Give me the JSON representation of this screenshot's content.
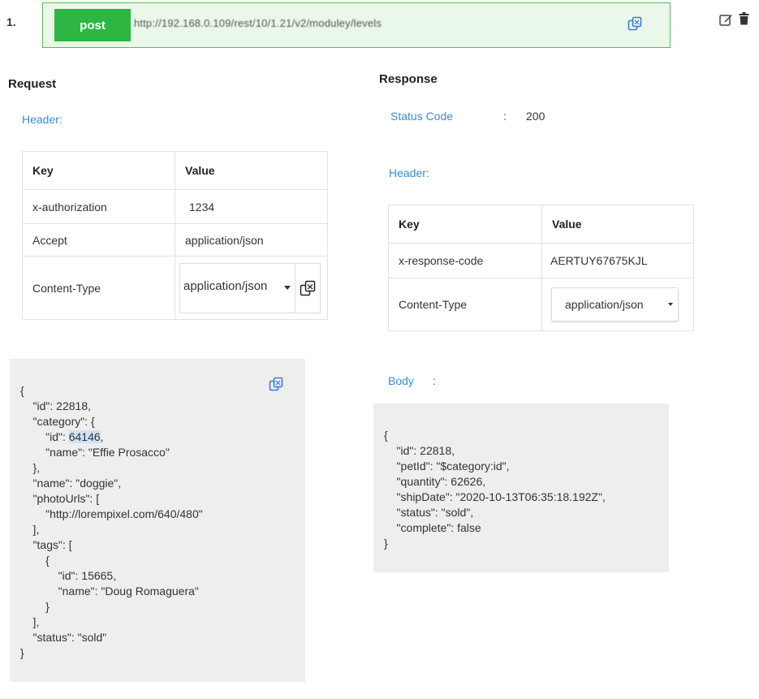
{
  "step": {
    "number": "1."
  },
  "endpoint": {
    "method": "post",
    "url": "http://192.168.0.109/rest/10/1.21/v2/moduley/levels"
  },
  "request": {
    "title": "Request",
    "header_label": "Header:",
    "table": {
      "key_header": "Key",
      "value_header": "Value",
      "rows": [
        {
          "key": "x-authorization",
          "value": "1234"
        },
        {
          "key": "Accept",
          "value": "application/json"
        },
        {
          "key": "Content-Type",
          "value": "application/json"
        }
      ]
    },
    "body": {
      "before_highlight": "{\n    \"id\": 22818,\n    \"category\": {\n        \"id\": ",
      "highlight": "64146",
      "after_highlight": ",\n        \"name\": \"Effie Prosacco\"\n    },\n    \"name\": \"doggie\",\n    \"photoUrls\": [\n        \"http://lorempixel.com/640/480\"\n    ],\n    \"tags\": [\n        {\n            \"id\": 15665,\n            \"name\": \"Doug Romaguera\"\n        }\n    ],\n    \"status\": \"sold\"\n}"
    }
  },
  "response": {
    "title": "Response",
    "status_label": "Status Code",
    "status_sep": ":",
    "status_value": "200",
    "header_label": "Header:",
    "table": {
      "key_header": "Key",
      "value_header": "Value",
      "rows": [
        {
          "key": "x-response-code",
          "value": "AERTUY67675KJL"
        },
        {
          "key": "Content-Type",
          "value": "application/json"
        }
      ]
    },
    "body_label": "Body",
    "body_sep": ":",
    "body": "{\n    \"id\": 22818,\n    \"petId\": \"$category:id\",\n    \"quantity\": 62626,\n    \"shipDate\": \"2020-10-13T06:35:18.192Z\",\n    \"status\": \"sold\",\n    \"complete\": false\n}"
  },
  "icons": {
    "copy": "copy-icon",
    "edit": "edit-icon",
    "delete": "trash-icon",
    "dropdown": "caret-down-icon"
  },
  "colors": {
    "method_bg": "#2db742",
    "url_bar_bg": "#eaf8ea",
    "url_bar_border": "#5cb85c",
    "label_blue": "#3a8bd6",
    "code_bg": "#eeeeee"
  }
}
